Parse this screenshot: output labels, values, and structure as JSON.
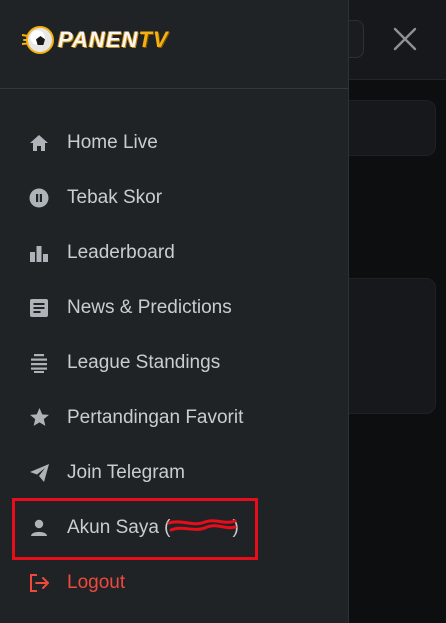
{
  "app": {
    "logo_text": "PANEN",
    "logo_text_accent": "TV"
  },
  "colors": {
    "drawer_bg": "#202326",
    "text": "#c9cdd1",
    "icon": "#aeb3b8",
    "logout": "#f0493c",
    "logo_accent": "#f4b10f",
    "highlight_box": "#e60e1a"
  },
  "menu": {
    "items": [
      {
        "label": "Home Live",
        "icon": "home-icon"
      },
      {
        "label": "Tebak Skor",
        "icon": "pause-circle-icon"
      },
      {
        "label": "Leaderboard",
        "icon": "bar-chart-icon"
      },
      {
        "label": "News & Predictions",
        "icon": "article-icon"
      },
      {
        "label": "League Standings",
        "icon": "list-lines-icon"
      },
      {
        "label": "Pertandingan Favorit",
        "icon": "star-icon"
      },
      {
        "label": "Join Telegram",
        "icon": "send-icon"
      },
      {
        "label": "Akun Saya (",
        "label_end": ")",
        "icon": "user-icon"
      },
      {
        "label": "Logout",
        "icon": "logout-icon"
      }
    ]
  },
  "close_icon": "close-icon"
}
